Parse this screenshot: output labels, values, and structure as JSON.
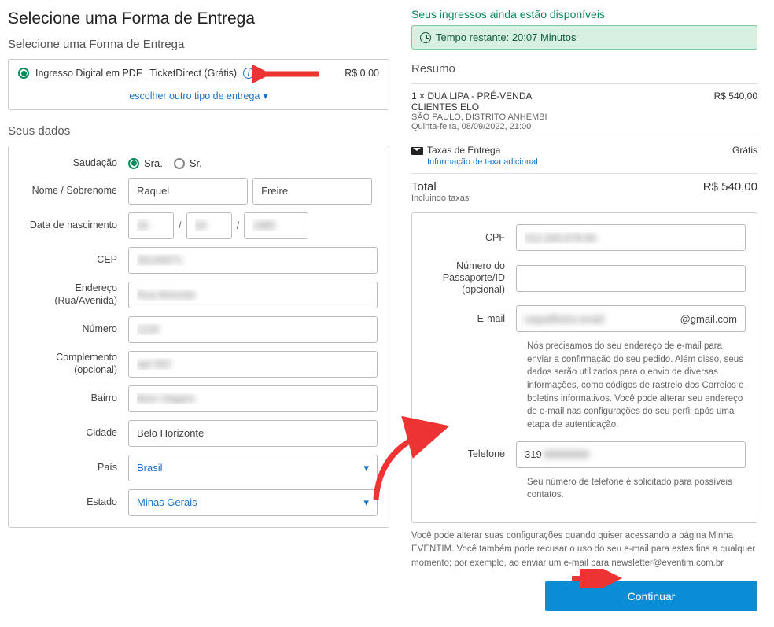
{
  "page": {
    "title": "Selecione uma Forma de Entrega"
  },
  "delivery": {
    "section_title": "Selecione uma Forma de Entrega",
    "option_label": "Ingresso Digital em PDF | TicketDirect (Grátis)",
    "option_price": "R$ 0,00",
    "alt_link": "escolher outro tipo de entrega"
  },
  "form": {
    "section_title": "Seus dados",
    "labels": {
      "saudacao": "Saudação",
      "nome": "Nome / Sobrenome",
      "nascimento": "Data de nascimento",
      "cep": "CEP",
      "endereco": "Endereço (Rua/Avenida)",
      "numero": "Número",
      "complemento": "Complemento (opcional)",
      "bairro": "Bairro",
      "cidade": "Cidade",
      "pais": "País",
      "estado": "Estado"
    },
    "saudacao_opts": {
      "sra": "Sra.",
      "sr": "Sr."
    },
    "values": {
      "nome": "Raquel",
      "sobrenome": "Freire",
      "dia": "20",
      "mes": "04",
      "ano": "1985",
      "cep": "30140071",
      "endereco": "Rua Almonte",
      "numero": "1126",
      "complemento": "apt 302",
      "bairro": "Bom Viagem",
      "cidade": "Belo Horizonte",
      "pais": "Brasil",
      "estado": "Minas Gerais"
    }
  },
  "right": {
    "avail_msg": "Seus ingressos ainda estão disponíveis",
    "timer_prefix": "Tempo restante: ",
    "timer_value": "20:07 Minutos",
    "summary_title": "Resumo",
    "item_qty_title": "1 × DUA LIPA - PRÉ-VENDA CLIENTES ELO",
    "item_price": "R$ 540,00",
    "item_venue": "SÃO PAULO, DISTRITO ANHEMBI",
    "item_date": "Quinta-feira, 08/09/2022, 21:00",
    "fees_label": "Taxas de Entrega",
    "fees_value": "Grátis",
    "fees_info": "Informação de taxa adicional",
    "total_label": "Total",
    "total_value": "R$ 540,00",
    "total_note": "Incluindo taxas"
  },
  "right_form": {
    "labels": {
      "cpf": "CPF",
      "passport": "Número do Passaporte/ID (opcional)",
      "email": "E-mail",
      "telefone": "Telefone"
    },
    "cpf_value": "012.345.678-90",
    "email_hidden": "raquelfreire.email",
    "email_domain": "@gmail.com",
    "email_helper": "Nós precisamos do seu endereço de e-mail para enviar a confirmação do seu pedido. Além disso, seus dados serão utilizados para o envio de diversas informações, como códigos de rastreio dos Correios e boletins informativos. Você pode alterar seu endereço de e-mail nas configurações do seu perfil após uma etapa de autenticação.",
    "phone_prefix": "319",
    "phone_hidden": "99999999",
    "phone_helper": "Seu número de telefone é solicitado para possíveis contatos.",
    "disclaimer": "Você pode alterar suas configurações quando quiser acessando a página Minha EVENTIM. Você também pode recusar o uso do seu e-mail para estes fins a qualquer momento; por exemplo, ao enviar um e-mail para newsletter@eventim.com.br",
    "continue_label": "Continuar"
  }
}
